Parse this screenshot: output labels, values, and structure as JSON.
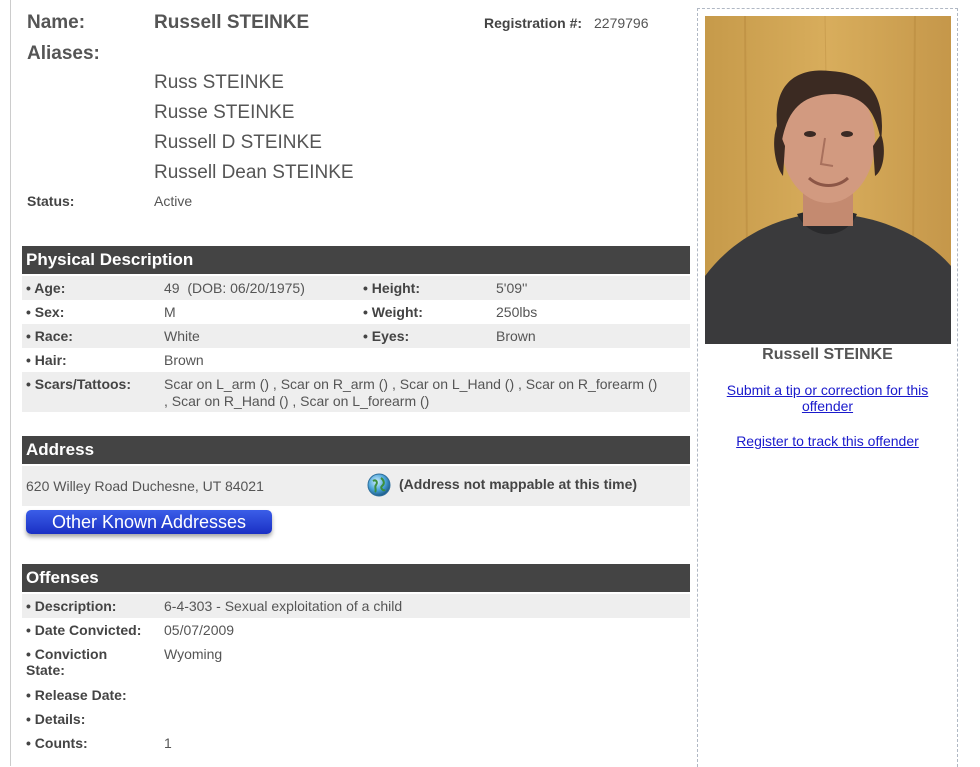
{
  "header": {
    "name_label": "Name:",
    "name_value": "Russell STEINKE",
    "registration_label": "Registration #:",
    "registration_value": "2279796",
    "aliases_label": "Aliases:",
    "aliases": [
      "Russ STEINKE",
      "Russe STEINKE",
      "Russell D STEINKE",
      "Russell Dean STEINKE"
    ],
    "status_label": "Status:",
    "status_value": "Active"
  },
  "physical": {
    "title": "Physical Description",
    "age_label": "• Age:",
    "age_value": "49  (DOB: 06/20/1975)",
    "height_label": "• Height:",
    "height_value": "5'09''",
    "sex_label": "• Sex:",
    "sex_value": "M",
    "weight_label": "• Weight:",
    "weight_value": "250lbs",
    "race_label": "• Race:",
    "race_value": "White",
    "eyes_label": "• Eyes:",
    "eyes_value": "Brown",
    "hair_label": "• Hair:",
    "hair_value": "Brown",
    "scars_label": "• Scars/Tattoos:",
    "scars_line1": "Scar on L_arm () , Scar on R_arm () , Scar on L_Hand () , Scar on R_forearm ()",
    "scars_line2": ", Scar on R_Hand () , Scar on L_forearm ()"
  },
  "address": {
    "title": "Address",
    "value": "620 Willey Road Duchesne, UT 84021",
    "map_note": "(Address not mappable at this time)",
    "other_button": "Other Known Addresses"
  },
  "offenses": {
    "title": "Offenses",
    "description_label": "• Description:",
    "description_value": "6-4-303 - Sexual exploitation of a child",
    "date_label": "• Date Convicted:",
    "date_value": "05/07/2009",
    "state_label_1": "• Conviction",
    "state_label_2": "State:",
    "state_value": "Wyoming",
    "release_label": "• Release Date:",
    "details_label": "• Details:",
    "counts_label": "• Counts:",
    "counts_value": "1"
  },
  "sidebar": {
    "photo_caption": "Russell STEINKE",
    "tip_link_line1": "Submit a tip or correction for this",
    "tip_link_line2": "offender",
    "track_link": "Register to track this offender"
  },
  "colors": {
    "section_header_bg": "#444444",
    "row_shade": "#eeeeee",
    "link": "#1a1acc",
    "button": "#1a2fc4"
  }
}
